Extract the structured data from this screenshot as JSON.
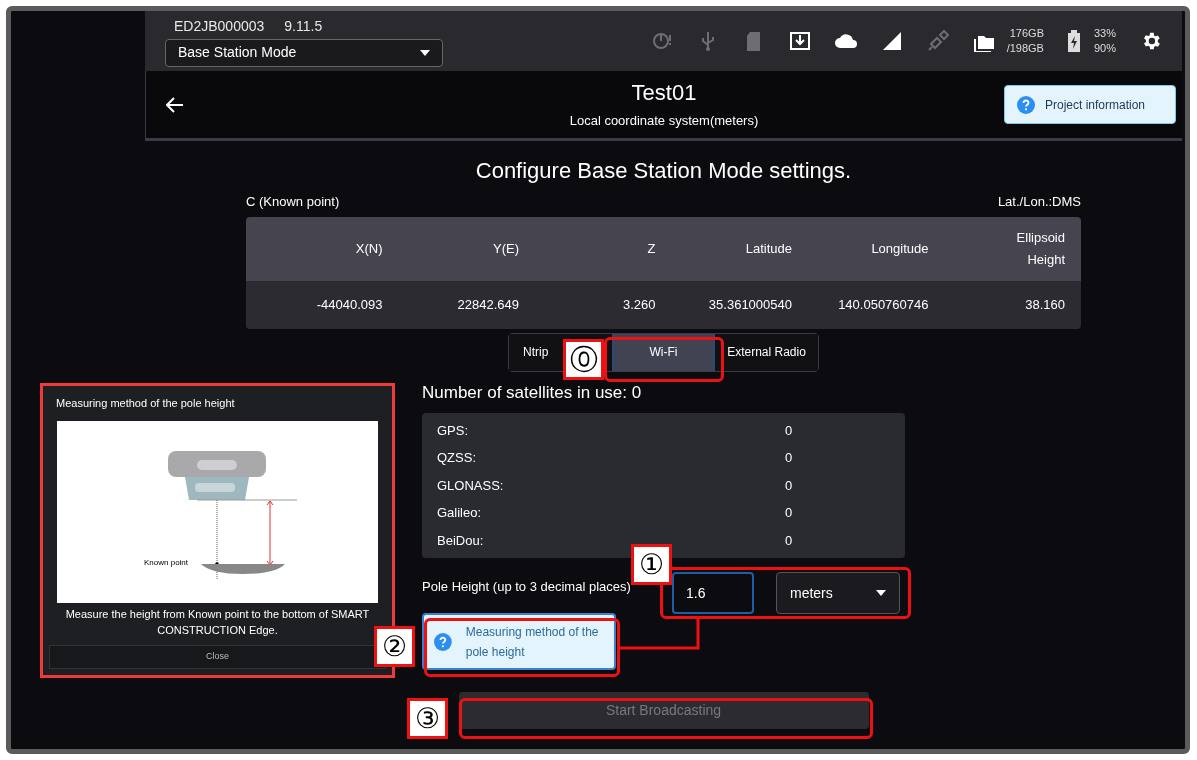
{
  "header": {
    "device_id": "ED2JB000003",
    "version": "9.11.5",
    "mode_select": "Base Station Mode",
    "status_icons": [
      {
        "kind": "timer",
        "on": false
      },
      {
        "kind": "usb",
        "on": false
      },
      {
        "kind": "sd",
        "on": false
      },
      {
        "kind": "download",
        "on": true
      },
      {
        "kind": "cloud",
        "on": true
      },
      {
        "kind": "signal",
        "on": true
      },
      {
        "kind": "satellite",
        "on": false
      },
      {
        "kind": "folder",
        "on": true
      }
    ],
    "storage": [
      "176GB",
      "/198GB"
    ],
    "battery": [
      "33%",
      "90%"
    ]
  },
  "title_bar": {
    "title": "Test01",
    "subtitle": "Local coordinate system(meters)",
    "info_button": "Project information"
  },
  "heading": "Configure Base Station Mode settings.",
  "point": {
    "label": "C (Known point)",
    "format": "Lat./Lon.:DMS",
    "columns": [
      "X(N)",
      "Y(E)",
      "Z",
      "Latitude",
      "Longitude",
      "Ellipsoid Height"
    ],
    "values": [
      "-44040.093",
      "22842.649",
      "3.260",
      "35.361000540",
      "140.050760746",
      "38.160"
    ]
  },
  "tabs": [
    {
      "label": "Ntrip",
      "selected": false
    },
    {
      "label": "Wi-Fi",
      "selected": true
    },
    {
      "label": "External Radio",
      "selected": false
    }
  ],
  "satellites": {
    "title": "Number of satellites in use: 0",
    "rows": [
      {
        "name": "GPS:",
        "count": "0"
      },
      {
        "name": "QZSS:",
        "count": "0"
      },
      {
        "name": "GLONASS:",
        "count": "0"
      },
      {
        "name": "Galileo:",
        "count": "0"
      },
      {
        "name": "BeiDou:",
        "count": "0"
      }
    ]
  },
  "pole_height": {
    "label": "Pole Height (up to 3 decimal places)",
    "value": "1.6",
    "unit": "meters",
    "help_button": "Measuring method of the pole height"
  },
  "start_button": {
    "label": "Start Broadcasting",
    "disabled": true
  },
  "help_dialog": {
    "title": "Measuring method of the pole height",
    "figure_label": "Known point",
    "description": "Measure the height from Known point to the bottom of SMART CONSTRUCTION Edge.",
    "close_button": "Close"
  },
  "callouts": [
    {
      "label": "⓪"
    },
    {
      "label": "①"
    },
    {
      "label": "②"
    },
    {
      "label": "③"
    }
  ]
}
